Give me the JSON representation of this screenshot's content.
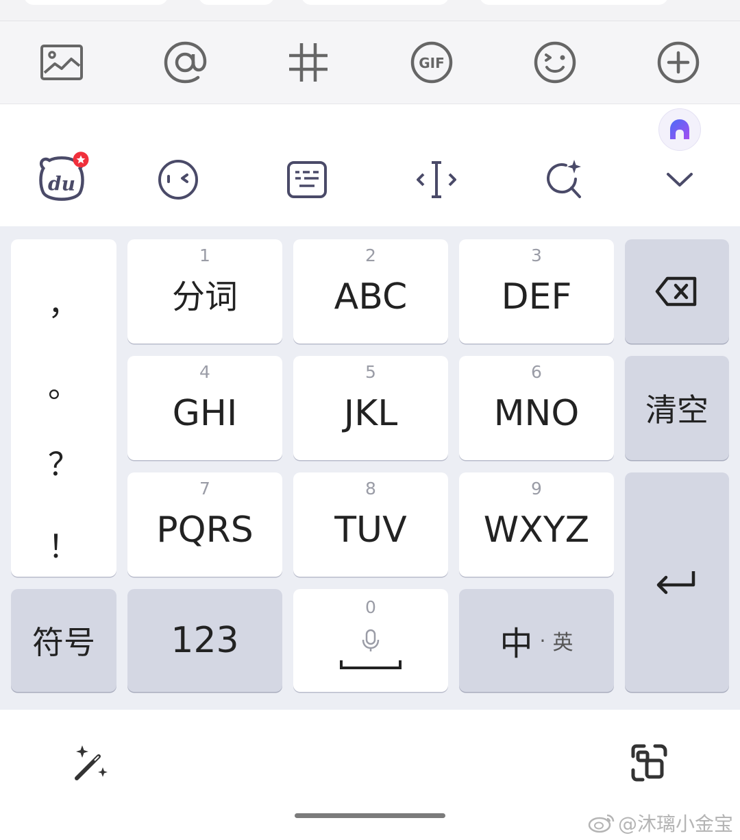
{
  "compose_toolbar": {
    "icons": [
      "image-icon",
      "at-mention-icon",
      "hashtag-icon",
      "gif-icon",
      "emoji-icon",
      "add-icon"
    ],
    "gif_text": "GIF"
  },
  "ime_toolbar": {
    "logo_text": "du",
    "icons": [
      "du-bear-logo-icon",
      "kaomoji-icon",
      "keyboard-layout-icon",
      "cursor-move-icon",
      "ai-search-icon",
      "collapse-chevron-icon"
    ],
    "ai_badge_icon": "ai-assistant-icon",
    "ai_badge_color": "#6b4df0"
  },
  "keyboard": {
    "punctuation": [
      "，",
      "。",
      "？",
      "！"
    ],
    "keys": [
      {
        "num": "1",
        "label": "分词"
      },
      {
        "num": "2",
        "label": "ABC"
      },
      {
        "num": "3",
        "label": "DEF"
      },
      {
        "num": "4",
        "label": "GHI"
      },
      {
        "num": "5",
        "label": "JKL"
      },
      {
        "num": "6",
        "label": "MNO"
      },
      {
        "num": "7",
        "label": "PQRS"
      },
      {
        "num": "8",
        "label": "TUV"
      },
      {
        "num": "9",
        "label": "WXYZ"
      }
    ],
    "backspace_icon": "backspace-icon",
    "clear_label": "清空",
    "enter_icon": "enter-icon",
    "symbols_label": "符号",
    "numbers_label": "123",
    "space_num": "0",
    "space_icon": "microphone-icon",
    "lang_primary": "中",
    "lang_dot": "·",
    "lang_secondary": "英"
  },
  "bottom": {
    "left_icon": "magic-wand-icon",
    "right_icon": "scan-text-icon"
  },
  "watermark": {
    "text": "@沐璃小金宝"
  }
}
